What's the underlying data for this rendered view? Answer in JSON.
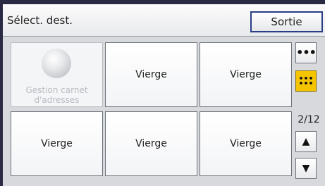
{
  "header": {
    "title": "Sélect. dest.",
    "exit_label": "Sortie"
  },
  "grid": {
    "tiles": [
      {
        "label": "Gestion carnet d'adresses",
        "disabled": true
      },
      {
        "label": "Vierge"
      },
      {
        "label": "Vierge"
      },
      {
        "label": "Vierge"
      },
      {
        "label": "Vierge"
      },
      {
        "label": "Vierge"
      }
    ]
  },
  "side": {
    "view_list_icon": "•••",
    "view_grid_icon": "⠿",
    "page_indicator": "2/12",
    "up_icon": "▲",
    "down_icon": "▼"
  },
  "colors": {
    "frame": "#2b2a45",
    "accent_border": "#2a3e86",
    "active_yellow": "#f5c400",
    "panel_bg": "#d7d9dd"
  }
}
